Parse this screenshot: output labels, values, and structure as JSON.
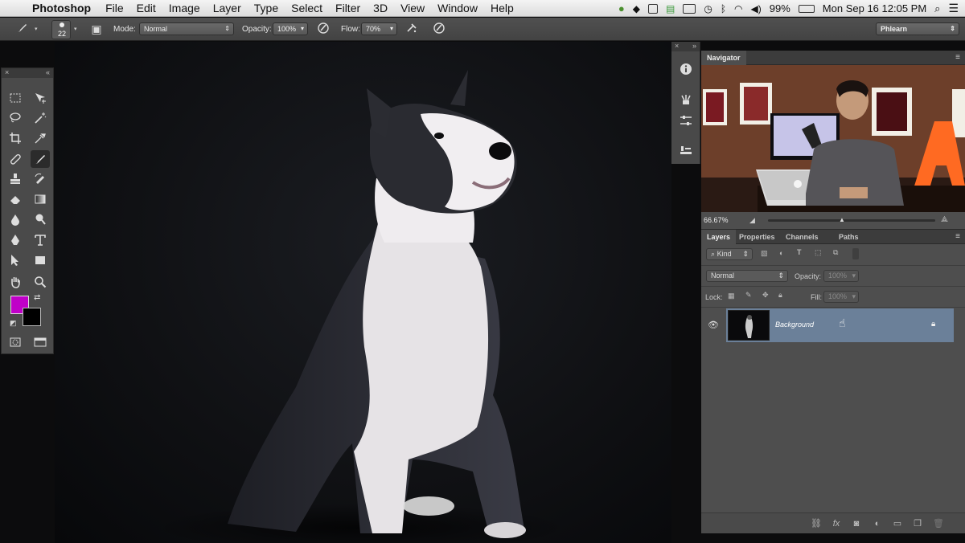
{
  "menubar": {
    "app_name": "Photoshop",
    "menus": [
      "File",
      "Edit",
      "Image",
      "Layer",
      "Type",
      "Select",
      "Filter",
      "3D",
      "View",
      "Window",
      "Help"
    ],
    "battery": "99%",
    "datetime": "Mon Sep 16  12:05 PM"
  },
  "options": {
    "brush_size": "22",
    "mode_label": "Mode:",
    "mode_value": "Normal",
    "opacity_label": "Opacity:",
    "opacity_value": "100%",
    "flow_label": "Flow:",
    "flow_value": "70%",
    "workspace": "Phlearn"
  },
  "colors": {
    "foreground": "#c000c8",
    "background": "#000000",
    "selected_layer": "#6b8099"
  },
  "navigator": {
    "tab": "Navigator",
    "zoom": "66.67%"
  },
  "layers": {
    "tabs": [
      "Layers",
      "Properties",
      "Channels",
      "Paths"
    ],
    "filter_label": "Kind",
    "blend_mode": "Normal",
    "opacity_label": "Opacity:",
    "opacity_value": "100%",
    "lock_label": "Lock:",
    "fill_label": "Fill:",
    "fill_value": "100%",
    "items": [
      {
        "name": "Background",
        "visible": true,
        "locked": true
      }
    ]
  }
}
